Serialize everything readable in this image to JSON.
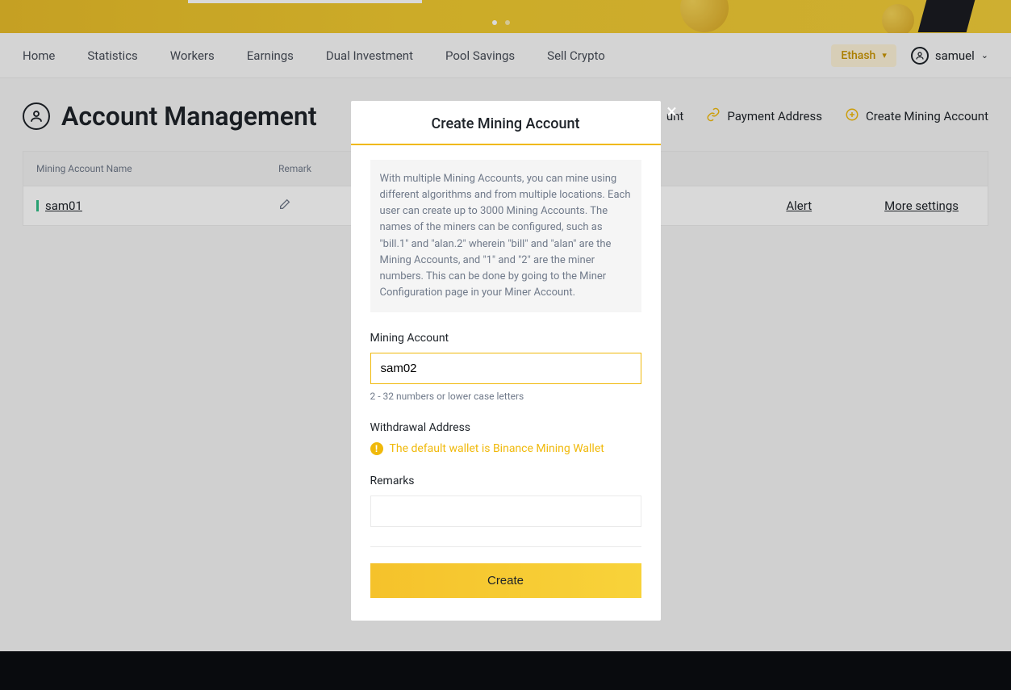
{
  "nav": {
    "links": [
      "Home",
      "Statistics",
      "Workers",
      "Earnings",
      "Dual Investment",
      "Pool Savings",
      "Sell Crypto"
    ],
    "algorithm": "Ethash",
    "username": "samuel"
  },
  "page": {
    "title": "Account Management",
    "actions": {
      "other_account_partial": "unt",
      "payment_address": "Payment Address",
      "create_mining_account": "Create Mining Account"
    }
  },
  "table": {
    "headers": {
      "name": "Mining Account Name",
      "remark": "Remark"
    },
    "rows": [
      {
        "name": "sam01",
        "alert": "Alert",
        "more": "More settings"
      }
    ]
  },
  "modal": {
    "title": "Create Mining Account",
    "info": "With multiple Mining Accounts, you can mine using different algorithms and from multiple locations. Each user can create up to 3000 Mining Accounts. The names of the miners can be configured, such as \"bill.1\" and \"alan.2\" wherein \"bill\" and \"alan\" are the Mining Accounts, and \"1\" and \"2\" are the miner numbers. This can be done by going to the Miner Configuration page in your Miner Account.",
    "mining_account_label": "Mining Account",
    "mining_account_value": "sam02",
    "mining_account_hint": "2 - 32 numbers or lower case letters",
    "withdrawal_label": "Withdrawal Address",
    "wallet_notice": "The default wallet is Binance Mining Wallet",
    "remarks_label": "Remarks",
    "remarks_value": "",
    "create_button": "Create"
  }
}
